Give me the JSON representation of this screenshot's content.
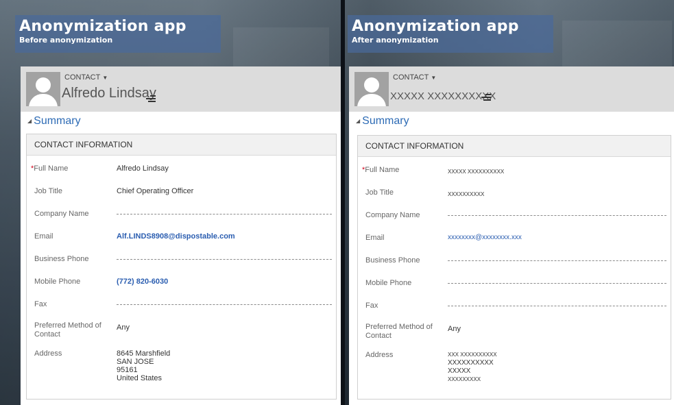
{
  "left": {
    "banner": {
      "title": "Anonymization app",
      "subtitle": "Before anonymization"
    },
    "entity_label": "CONTACT",
    "record_name": "Alfredo Lindsay",
    "section_toggle": "Summary",
    "section_title": "CONTACT INFORMATION",
    "fields": {
      "full_name": {
        "label": "Full Name",
        "value": "Alfredo Lindsay"
      },
      "job_title": {
        "label": "Job Title",
        "value": "Chief Operating Officer"
      },
      "company_name": {
        "label": "Company Name",
        "value": ""
      },
      "email": {
        "label": "Email",
        "value": "Alf.LINDS8908@dispostable.com"
      },
      "business_phone": {
        "label": "Business Phone",
        "value": ""
      },
      "mobile_phone": {
        "label": "Mobile Phone",
        "value": "(772) 820-6030"
      },
      "fax": {
        "label": "Fax",
        "value": ""
      },
      "preferred_contact": {
        "label": "Preferred Method of Contact",
        "value": "Any"
      },
      "address": {
        "label": "Address",
        "line1": "8645 Marshfield",
        "line2": "SAN JOSE",
        "line3": "95161",
        "line4": "United States"
      }
    }
  },
  "right": {
    "banner": {
      "title": "Anonymization app",
      "subtitle": "After anonymization"
    },
    "entity_label": "CONTACT",
    "record_name": "XXXXX XXXXXXXXXX",
    "section_toggle": "Summary",
    "section_title": "CONTACT INFORMATION",
    "fields": {
      "full_name": {
        "label": "Full Name",
        "value": "XXXXX XXXXXXXXXX"
      },
      "job_title": {
        "label": "Job Title",
        "value": "XXXXXXXXXX"
      },
      "company_name": {
        "label": "Company Name",
        "value": ""
      },
      "email": {
        "label": "Email",
        "value": "xxxxxxxx@xxxxxxxx.xxx"
      },
      "business_phone": {
        "label": "Business Phone",
        "value": ""
      },
      "mobile_phone": {
        "label": "Mobile Phone",
        "value": ""
      },
      "fax": {
        "label": "Fax",
        "value": ""
      },
      "preferred_contact": {
        "label": "Preferred Method of Contact",
        "value": "Any"
      },
      "address": {
        "label": "Address",
        "line1": "XXX XXXXXXXXXX",
        "line2": "XXXXXXXXXX",
        "line3": "XXXXX",
        "line4": "XXXXXXXXX"
      }
    }
  },
  "icons": {
    "caret": "dropdown-caret-icon",
    "menu": "record-menu-icon",
    "avatar": "contact-avatar-icon",
    "collapse": "collapse-triangle-icon"
  },
  "colors": {
    "banner": "#4a6a9a",
    "link": "#2a5db0",
    "required": "#d0021b",
    "header_bg": "#dcdcdc"
  }
}
